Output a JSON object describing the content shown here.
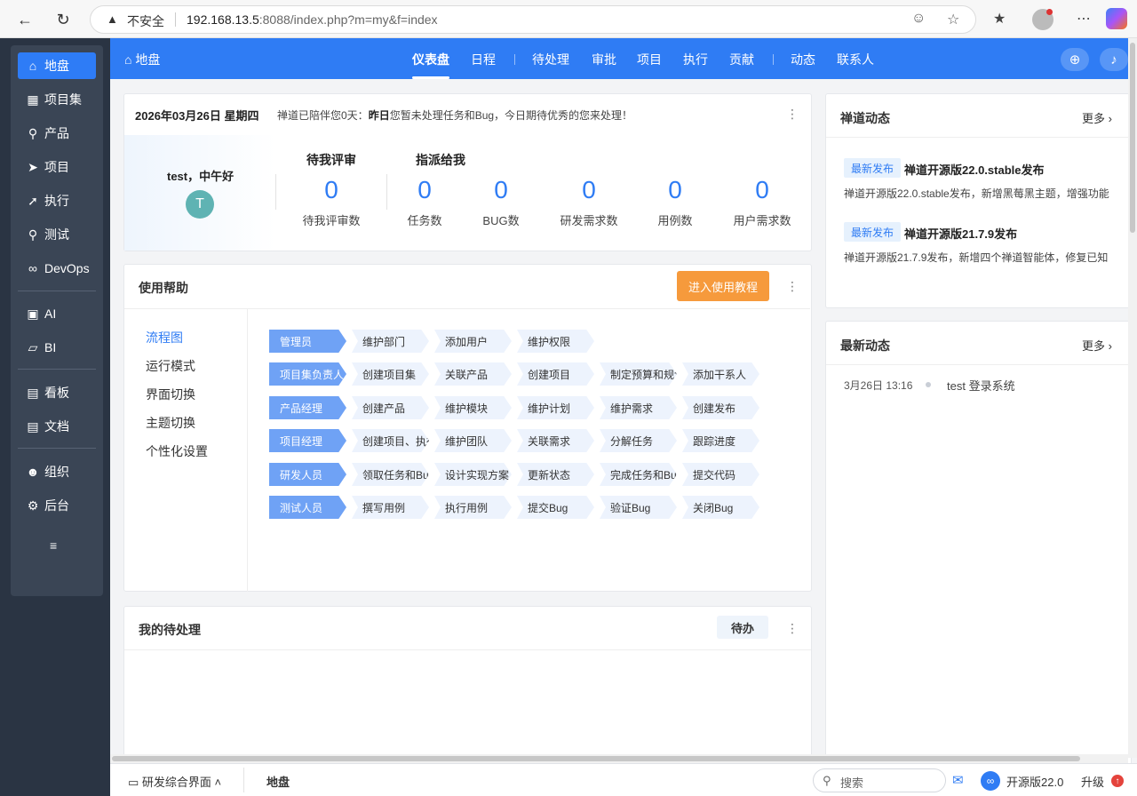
{
  "browser": {
    "insecure_label": "不安全",
    "url_host": "192.168.13.5",
    "url_rest": ":8088/index.php?m=my&f=index"
  },
  "sidebar": {
    "items": [
      {
        "label": "地盘",
        "icon": "home-icon"
      },
      {
        "label": "项目集",
        "icon": "grid-icon"
      },
      {
        "label": "产品",
        "icon": "bulb-icon"
      },
      {
        "label": "项目",
        "icon": "rocket-icon"
      },
      {
        "label": "执行",
        "icon": "run-icon"
      },
      {
        "label": "测试",
        "icon": "search-bug-icon"
      },
      {
        "label": "DevOps",
        "icon": "infinity-icon"
      },
      {
        "label": "AI",
        "icon": "robot-icon"
      },
      {
        "label": "BI",
        "icon": "chart-icon"
      },
      {
        "label": "看板",
        "icon": "board-icon"
      },
      {
        "label": "文档",
        "icon": "doc-icon"
      },
      {
        "label": "组织",
        "icon": "people-icon"
      },
      {
        "label": "后台",
        "icon": "gear-icon"
      }
    ]
  },
  "header": {
    "home_label": "地盘",
    "tabs": [
      {
        "label": "仪表盘"
      },
      {
        "label": "日程"
      },
      {
        "label": "待处理"
      },
      {
        "label": "审批"
      },
      {
        "label": "项目"
      },
      {
        "label": "执行"
      },
      {
        "label": "贡献"
      },
      {
        "label": "动态"
      },
      {
        "label": "联系人"
      }
    ]
  },
  "welcome": {
    "date": "2026年03月26日 星期四",
    "msg_prefix": "禅道已陪伴您0天：",
    "msg_bold": "昨日",
    "msg_suffix": "您暂未处理任务和Bug，今日期待优秀的您来处理！",
    "greeting": "test，中午好",
    "avatar_letter": "T",
    "review_title": "待我评审",
    "assign_title": "指派给我",
    "stats": [
      {
        "value": "0",
        "label": "待我评审数"
      },
      {
        "value": "0",
        "label": "任务数"
      },
      {
        "value": "0",
        "label": "BUG数"
      },
      {
        "value": "0",
        "label": "研发需求数"
      },
      {
        "value": "0",
        "label": "用例数"
      },
      {
        "value": "0",
        "label": "用户需求数"
      }
    ]
  },
  "help": {
    "title": "使用帮助",
    "tutorial_button": "进入使用教程",
    "nav": [
      "流程图",
      "运行模式",
      "界面切换",
      "主题切换",
      "个性化设置"
    ],
    "flows": [
      {
        "role": "管理员",
        "steps": [
          "维护部门",
          "添加用户",
          "维护权限"
        ]
      },
      {
        "role": "项目集负责人",
        "steps": [
          "创建项目集",
          "关联产品",
          "创建项目",
          "制定预算和规划",
          "添加干系人"
        ]
      },
      {
        "role": "产品经理",
        "steps": [
          "创建产品",
          "维护模块",
          "维护计划",
          "维护需求",
          "创建发布"
        ]
      },
      {
        "role": "项目经理",
        "steps": [
          "创建项目、执行",
          "维护团队",
          "关联需求",
          "分解任务",
          "跟踪进度"
        ]
      },
      {
        "role": "研发人员",
        "steps": [
          "领取任务和Bug",
          "设计实现方案",
          "更新状态",
          "完成任务和Bug",
          "提交代码"
        ]
      },
      {
        "role": "测试人员",
        "steps": [
          "撰写用例",
          "执行用例",
          "提交Bug",
          "验证Bug",
          "关闭Bug"
        ]
      }
    ]
  },
  "todo": {
    "title": "我的待处理",
    "button": "待办"
  },
  "news": {
    "title": "禅道动态",
    "more": "更多",
    "items": [
      {
        "tag": "最新发布",
        "title": "禅道开源版22.0.stable发布",
        "desc": "禅道开源版22.0.stable发布，新增黑莓黑主题，增强功能"
      },
      {
        "tag": "最新发布",
        "title": "禅道开源版21.7.9发布",
        "desc": "禅道开源版21.7.9发布，新增四个禅道智能体，修复已知"
      }
    ]
  },
  "dynamics": {
    "title": "最新动态",
    "more": "更多",
    "items": [
      {
        "time": "3月26日 13:16",
        "text": "test 登录系统"
      }
    ]
  },
  "footer": {
    "layout_label": "研发综合界面",
    "breadcrumb": "地盘",
    "search_placeholder": "搜索",
    "version": "开源版22.0",
    "upgrade": "升级"
  }
}
